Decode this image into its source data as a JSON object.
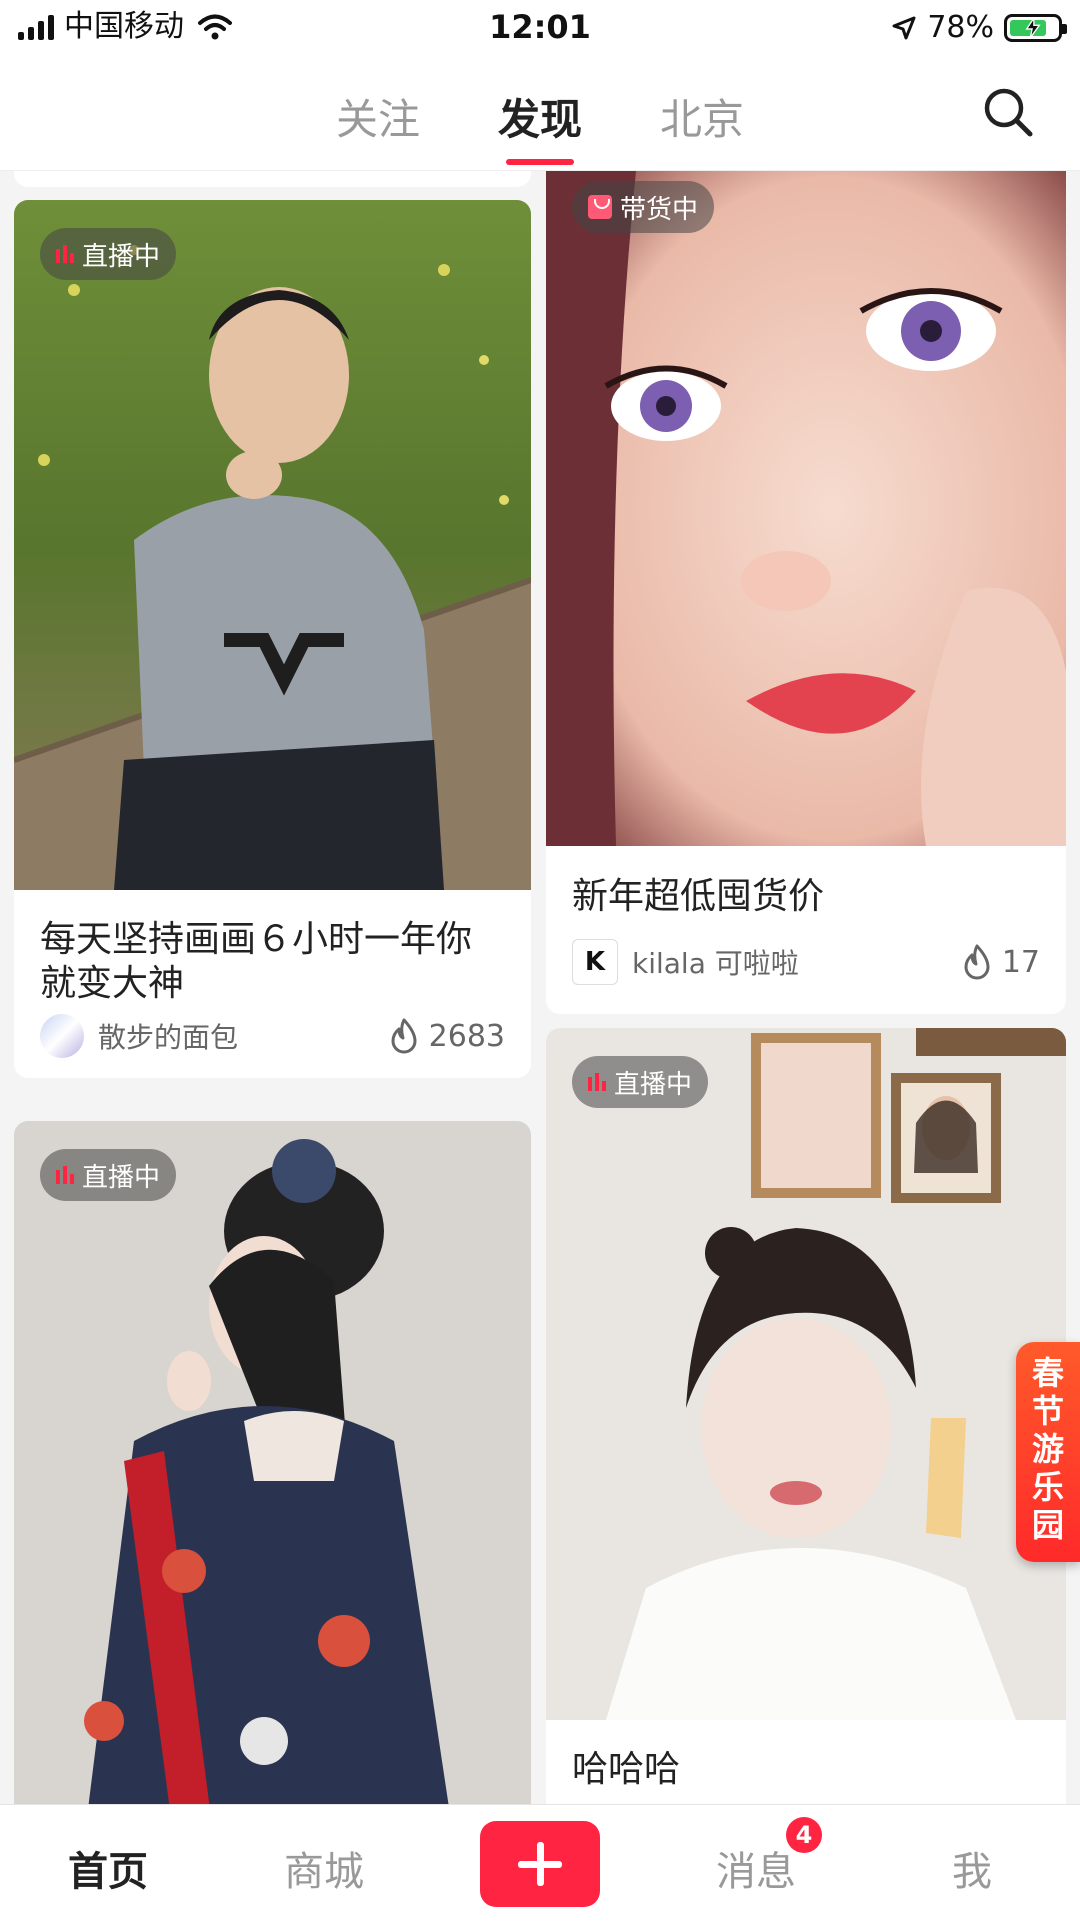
{
  "status_bar": {
    "carrier": "中国移动",
    "time": "12:01",
    "battery_percent": "78%",
    "battery_level": 0.78,
    "icons": [
      "signal-icon",
      "wifi-icon",
      "location-arrow-icon",
      "battery-charging-icon"
    ]
  },
  "top_nav": {
    "tabs": [
      {
        "label": "关注",
        "active": false
      },
      {
        "label": "发现",
        "active": true
      },
      {
        "label": "北京",
        "active": false
      }
    ],
    "search_icon": "search-icon"
  },
  "feed": {
    "cards": [
      {
        "badge": "直播中",
        "title": "每天坚持画画６小时一年你就变大神",
        "author": "散步的面包",
        "likes": "2683",
        "photo_desc": "man-in-gray-hoodie"
      },
      {
        "badge": "带货中",
        "title": "新年超低囤货价",
        "author": "kilala 可啦啦",
        "likes": "17",
        "photo_desc": "makeup-closeup"
      },
      {
        "badge": "直播中",
        "title": "",
        "author": "",
        "likes": "",
        "photo_desc": "woman-in-hanfu"
      },
      {
        "badge": "直播中",
        "title": "哈哈哈",
        "author": "",
        "likes": "",
        "photo_desc": "woman-with-hair-bun"
      }
    ]
  },
  "float_banner": {
    "label": "春节游乐园"
  },
  "bottom_nav": {
    "items": [
      {
        "label": "首页",
        "active": true
      },
      {
        "label": "商城",
        "active": false
      },
      {
        "label": "消息",
        "active": false,
        "badge": "4"
      },
      {
        "label": "我",
        "active": false
      }
    ],
    "plus_icon": "plus-icon"
  },
  "colors": {
    "accent": "#ff2442",
    "badge_bg": "#464646"
  }
}
